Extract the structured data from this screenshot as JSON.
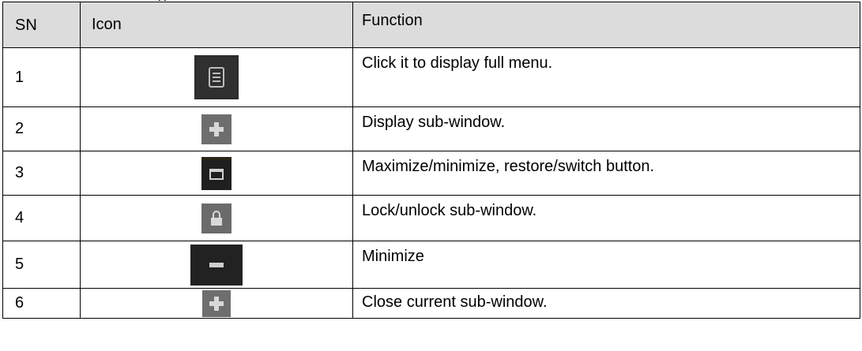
{
  "caption": "g",
  "table": {
    "headers": {
      "sn": "SN",
      "icon": "Icon",
      "function": "Function"
    },
    "rows": [
      {
        "sn": "1",
        "icon": "full-menu-icon",
        "function": "Click it to display full menu."
      },
      {
        "sn": "2",
        "icon": "plus-icon",
        "function": "Display sub-window."
      },
      {
        "sn": "3",
        "icon": "window-icon",
        "function": "Maximize/minimize, restore/switch button."
      },
      {
        "sn": "4",
        "icon": "lock-icon",
        "function": "Lock/unlock sub-window."
      },
      {
        "sn": "5",
        "icon": "minus-icon",
        "function": "Minimize"
      },
      {
        "sn": "6",
        "icon": "plus-icon",
        "function": "Close current sub-window."
      }
    ]
  }
}
